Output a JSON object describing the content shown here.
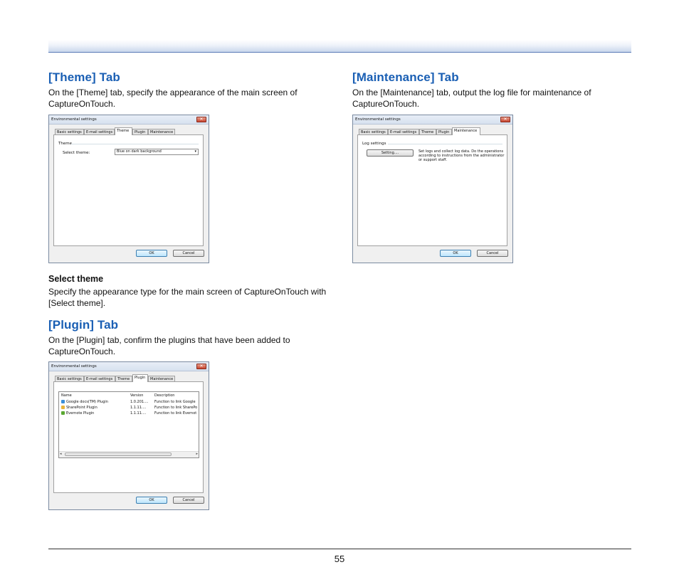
{
  "page": {
    "number": "55"
  },
  "theme_section": {
    "title": "[Theme] Tab",
    "intro": "On the [Theme] tab, specify the appearance of the main screen of CaptureOnTouch.",
    "select_theme_heading": "Select theme",
    "select_theme_text": "Specify the appearance type for the main screen of CaptureOnTouch with [Select theme]."
  },
  "plugin_section": {
    "title": "[Plugin] Tab",
    "intro": "On the [Plugin] tab, confirm the plugins that have been added to CaptureOnTouch."
  },
  "maintenance_section": {
    "title": "[Maintenance] Tab",
    "intro": "On the [Maintenance] tab, output the log file for maintenance of CaptureOnTouch."
  },
  "dialog": {
    "title": "Environmental settings",
    "close_glyph": "✕",
    "tabs": [
      "Basic settings",
      "E-mail settings",
      "Theme",
      "Plugin",
      "Maintenance"
    ],
    "ok_label": "OK",
    "cancel_label": "Cancel"
  },
  "theme_dialog": {
    "group_label": "Theme",
    "select_label": "Select theme:",
    "select_value": "Blue on dark background"
  },
  "plugin_dialog": {
    "columns": [
      "Name",
      "Version",
      "Description"
    ],
    "rows": [
      {
        "name": "Google docs(TM) Plugin",
        "version": "1.0.201....",
        "description": "Function to link Google",
        "icon": "google-docs-icon"
      },
      {
        "name": "SharePoint Plugin",
        "version": "1.1.11....",
        "description": "Function to link SharePo",
        "icon": "sharepoint-icon"
      },
      {
        "name": "Evernote Plugin",
        "version": "1.1.11....",
        "description": "Function to link Evernot",
        "icon": "evernote-icon"
      }
    ]
  },
  "maintenance_dialog": {
    "group_label": "Log settings",
    "setting_button": "Setting....",
    "description": "Set logs and collect log data. Do the operations according to instructions from the administrator or support staff."
  },
  "colors": {
    "section_title": "#1a5fb4",
    "header_band_edge": "#5a7bb6"
  }
}
